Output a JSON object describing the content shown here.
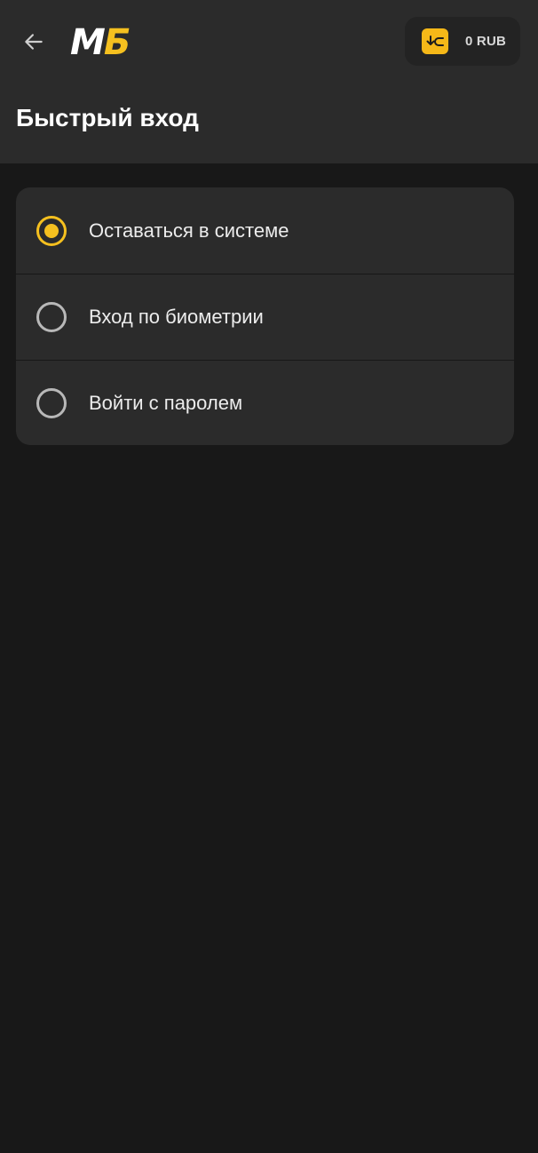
{
  "header": {
    "back_icon": "arrow-left-icon",
    "logo": {
      "part1": "М",
      "part2": "Б"
    },
    "balance": {
      "icon": "wallet-deposit-icon",
      "text": "0 RUB",
      "icon_color": "#f5b818"
    },
    "title": "Быстрый вход"
  },
  "options": [
    {
      "label": "Оставаться в системе",
      "selected": true
    },
    {
      "label": "Вход по биометрии",
      "selected": false
    },
    {
      "label": "Войти с паролем",
      "selected": false
    }
  ],
  "colors": {
    "accent": "#f5c01f",
    "background": "#181818",
    "surface": "#2b2b2b",
    "radio_unchecked": "#b8b8b8"
  }
}
